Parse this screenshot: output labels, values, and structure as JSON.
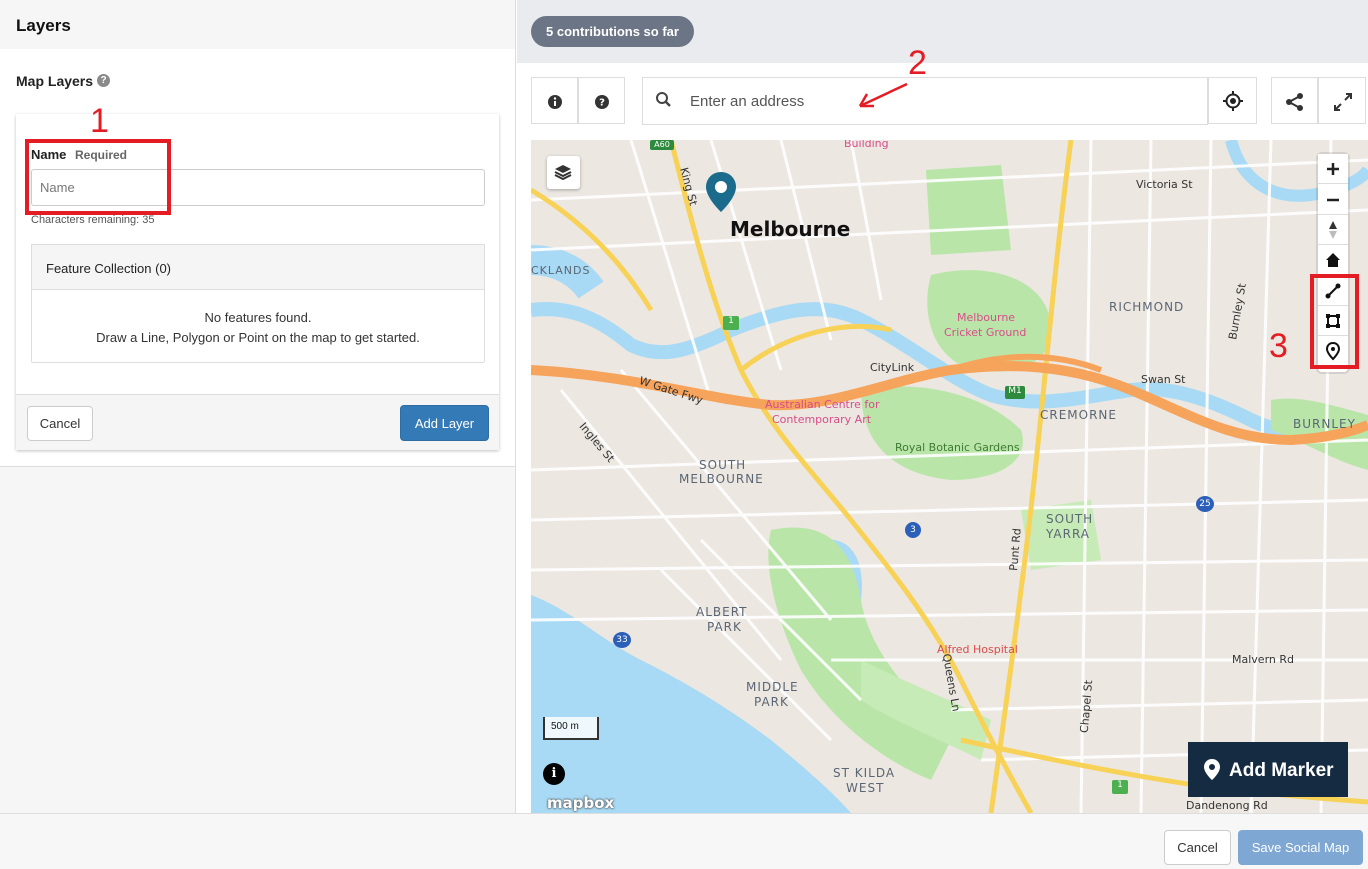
{
  "left_panel": {
    "title": "Layers",
    "map_layers_title": "Map Layers",
    "help_glyph": "?",
    "form": {
      "name_label": "Name",
      "name_required": "Required",
      "name_placeholder": "Name",
      "name_value": "",
      "chars_remaining": "Characters remaining: 35",
      "feature_collection_title": "Feature Collection (0)",
      "empty_line1": "No features found.",
      "empty_line2": "Draw a Line, Polygon or Point on the map to get started.",
      "cancel_label": "Cancel",
      "add_layer_label": "Add Layer"
    }
  },
  "map_panel": {
    "contributions": "5 contributions so far",
    "search_placeholder": "Enter an address",
    "search_value": "",
    "map_labels": {
      "city": "Melbourne",
      "docklands": "CKLANDS",
      "richmond": "RICHMOND",
      "cremorne": "CREMORNE",
      "burnley": "BURNLEY",
      "south_melbourne_1": "SOUTH",
      "south_melbourne_2": "MELBOURNE",
      "south_yarra_1": "SOUTH",
      "south_yarra_2": "YARRA",
      "albert_park_1": "ALBERT",
      "albert_park_2": "PARK",
      "middle_park_1": "MIDDLE",
      "middle_park_2": "PARK",
      "st_kilda_1": "ST KILDA",
      "st_kilda_2": "WEST",
      "mcg_1": "Melbourne",
      "mcg_2": "Cricket Ground",
      "acca_1": "Australian Centre for",
      "acca_2": "Contemporary Art",
      "botanic": "Royal Botanic Gardens",
      "alfred": "Alfred Hospital",
      "victoria_st": "Victoria St",
      "swan_st": "Swan St",
      "malvern_rd": "Malvern Rd",
      "dandenong_rd": "Dandenong Rd",
      "citylink": "CityLink",
      "w_gate_fwy": "W Gate Fwy",
      "ingles_st": "Ingles St",
      "king_st": "King St",
      "punt_rd": "Punt Rd",
      "queens_ln": "Queens Ln",
      "chapel_st": "Chapel St",
      "burnley_st": "Burnley St",
      "building": "Building",
      "route_1a": "1",
      "route_1b": "1",
      "route_m1": "M1",
      "route_a60": "A60",
      "route_3": "3",
      "route_25": "25",
      "route_33": "33",
      "scale": "500 m",
      "attribution": "mapbox"
    },
    "add_marker_label": "Add Marker"
  },
  "annotations": {
    "n1": "1",
    "n2": "2",
    "n3": "3"
  },
  "footer": {
    "cancel_label": "Cancel",
    "save_label": "Save Social Map"
  },
  "colors": {
    "primary": "#337ab7",
    "primary_disabled": "#7ea8d3",
    "annotation_red": "#e41d24",
    "add_marker_bg": "#152b42",
    "water": "#a8daf5",
    "park": "#b9e6a8",
    "major_road": "#f7d257",
    "freeway": "#f6a35b"
  }
}
